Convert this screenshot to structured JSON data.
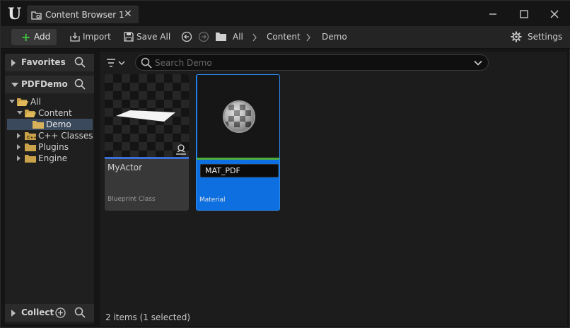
{
  "titlebar": {
    "tab_title": "Content Browser 1",
    "tab_close": "✕"
  },
  "toolbar": {
    "add_label": "Add",
    "import_label": "Import",
    "save_all_label": "Save All",
    "settings_label": "Settings",
    "breadcrumbs": [
      "All",
      "Content",
      "Demo"
    ]
  },
  "sources": {
    "favorites_label": "Favorites",
    "project_label": "PDFDemo",
    "collect_label": "Collect",
    "tree": [
      {
        "label": "All",
        "expanded": true
      },
      {
        "label": "Content",
        "expanded": true
      },
      {
        "label": "Demo",
        "selected": true
      },
      {
        "label": "C++ Classes",
        "expanded": false
      },
      {
        "label": "Plugins",
        "expanded": false
      },
      {
        "label": "Engine",
        "expanded": false
      }
    ]
  },
  "search": {
    "placeholder": "Search Demo"
  },
  "assets": [
    {
      "name": "MyActor",
      "type": "Blueprint Class",
      "accent": "#3b6fd6"
    },
    {
      "name": "MAT_PDF",
      "type": "Material",
      "accent": "#4cad3c",
      "selected": true,
      "renaming": true
    }
  ],
  "status": {
    "text": "2 items (1 selected)"
  },
  "colors": {
    "selection": "#0e6fe0",
    "add_plus": "#3fc53f"
  }
}
